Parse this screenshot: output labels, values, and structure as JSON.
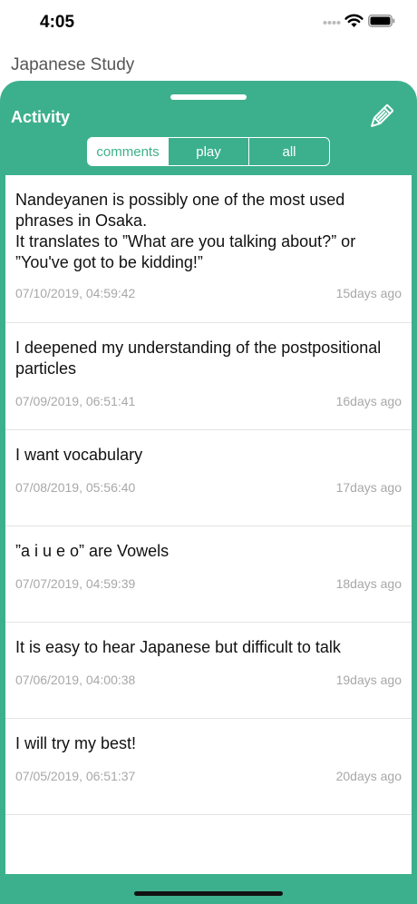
{
  "status_bar": {
    "time": "4:05"
  },
  "app": {
    "title": "Japanese Study"
  },
  "sheet": {
    "title": "Activity",
    "segments": [
      {
        "label": "comments",
        "selected": true
      },
      {
        "label": "play",
        "selected": false
      },
      {
        "label": "all",
        "selected": false
      }
    ]
  },
  "activity": [
    {
      "text": "Nandeyanen is possibly one of the most used phrases in Osaka.\nIt translates to ”What are you talking about?” or ”You've got to be kidding!”",
      "date": "07/10/2019, 04:59:42",
      "ago": "15days ago"
    },
    {
      "text": "I deepened my understanding of the postpositional particles",
      "date": "07/09/2019, 06:51:41",
      "ago": "16days ago"
    },
    {
      "text": "I want vocabulary",
      "date": "07/08/2019, 05:56:40",
      "ago": "17days ago"
    },
    {
      "text": "”a i u e o” are Vowels",
      "date": "07/07/2019, 04:59:39",
      "ago": "18days ago"
    },
    {
      "text": "It is easy to hear Japanese but difficult to talk",
      "date": "07/06/2019, 04:00:38",
      "ago": "19days ago"
    },
    {
      "text": "I will try my best!",
      "date": "07/05/2019, 06:51:37",
      "ago": "20days ago"
    }
  ],
  "colors": {
    "accent": "#3cb08c",
    "meta_text": "#a8a8a8"
  },
  "icons": {
    "edit": "pencil-icon",
    "signal": "cellular-signal-icon",
    "wifi": "wifi-icon",
    "battery": "battery-icon"
  }
}
